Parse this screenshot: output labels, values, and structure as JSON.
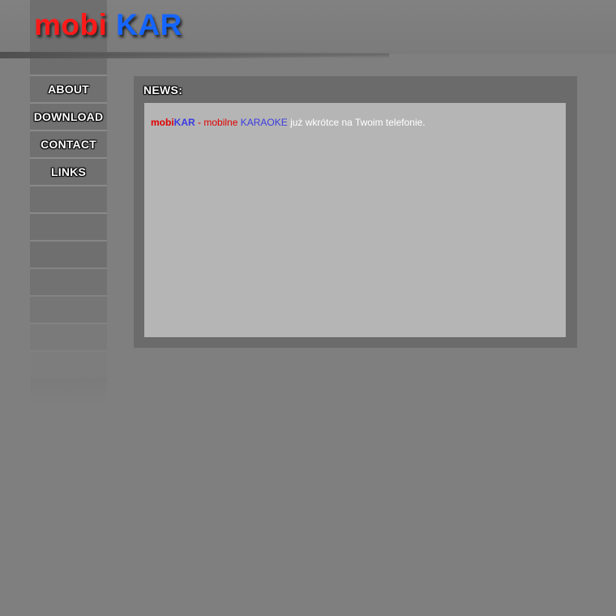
{
  "brand": {
    "part1": "mobi",
    "part2": "KAR",
    "colors": {
      "part1": "#ff1a1a",
      "part2": "#1565ff"
    }
  },
  "nav": {
    "items": [
      {
        "label": "ABOUT"
      },
      {
        "label": "DOWNLOAD"
      },
      {
        "label": "CONTACT"
      },
      {
        "label": "LINKS"
      }
    ]
  },
  "news": {
    "title": "NEWS:",
    "item": {
      "brand_mobi": "mobi",
      "brand_kar": "KAR",
      "separator": " - ",
      "mobilne": "mobilne",
      "karaoke": "KARAOKE",
      "rest": "już wkrótce na Twoim telefonie."
    }
  }
}
